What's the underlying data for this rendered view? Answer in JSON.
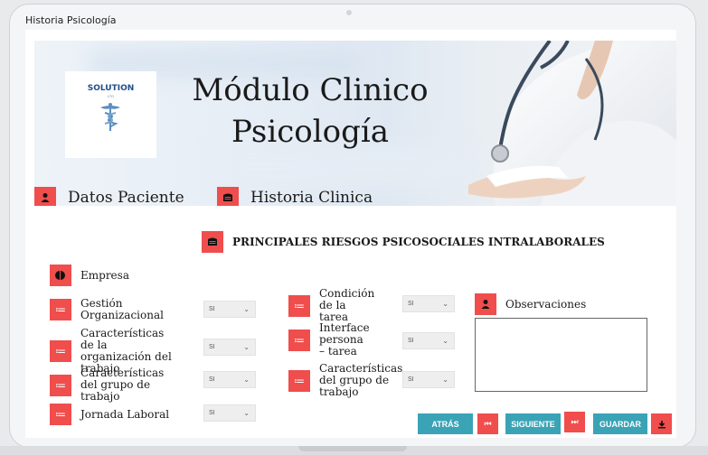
{
  "window": {
    "title": "Historia Psicología"
  },
  "header": {
    "logo_text": "SOLUTION",
    "logo_sub": "LTD",
    "title_line1": "Módulo Clinico",
    "title_line2": "Psicología"
  },
  "nav": [
    {
      "label": "Datos Paciente",
      "icon": "user-icon"
    },
    {
      "label": "Historia Clinica",
      "icon": "archive-icon"
    }
  ],
  "section": {
    "title": "PRINCIPALES RIESGOS PSICOSOCIALES INTRALABORALES",
    "icon": "archive-icon"
  },
  "company": {
    "label": "Empresa",
    "icon": "pie-chart-icon"
  },
  "fields": [
    {
      "label": "Gestión Organizacional",
      "value": "SI"
    },
    {
      "label": "Características de la organización del trabajo",
      "value": "SI"
    },
    {
      "label": "Características del grupo de trabajo",
      "value": "SI"
    },
    {
      "label": "Jornada Laboral",
      "value": "SI"
    },
    {
      "label": "Condición de la tarea",
      "value": "SI"
    },
    {
      "label": "Interface persona – tarea",
      "value": "SI"
    },
    {
      "label": "Características del grupo de trabajo",
      "value": "SI"
    }
  ],
  "observations": {
    "label": "Observaciones",
    "value": ""
  },
  "actions": {
    "back": "ATRÁS",
    "next": "SIGUIENTE",
    "save": "GUARDAR"
  },
  "colors": {
    "accent_red": "#f04d4d",
    "accent_teal": "#3aa3b6"
  }
}
